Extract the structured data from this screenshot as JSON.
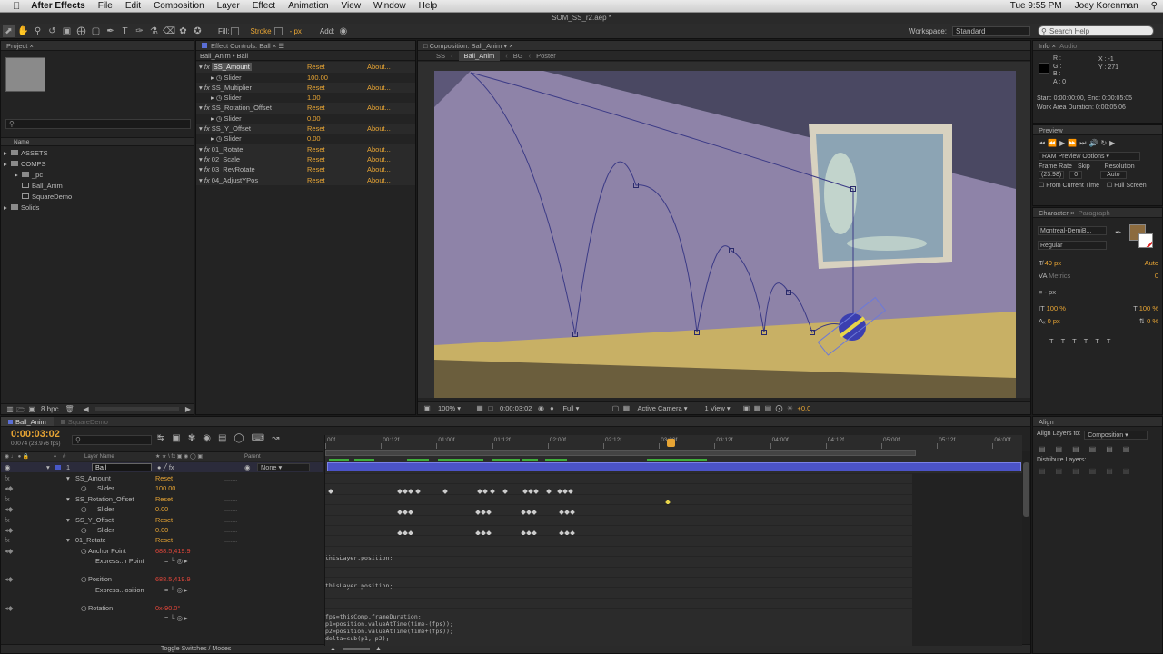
{
  "menubar": {
    "app": "After Effects",
    "items": [
      "File",
      "Edit",
      "Composition",
      "Layer",
      "Effect",
      "Animation",
      "View",
      "Window",
      "Help"
    ],
    "clock": "Tue 9:55 PM",
    "user": "Joey Korenman"
  },
  "window_title": "SOM_SS_r2.aep *",
  "toolbar": {
    "fill_label": "Fill:",
    "stroke_label": "Stroke",
    "px_label": "- px",
    "add_label": "Add:",
    "workspace_label": "Workspace:",
    "workspace_value": "Standard",
    "search_placeholder": "Search Help"
  },
  "project": {
    "tab": "Project",
    "column_name": "Name",
    "search_placeholder": "",
    "items": [
      {
        "label": "ASSETS",
        "indent": 0,
        "kind": "folder"
      },
      {
        "label": "COMPS",
        "indent": 0,
        "kind": "folder"
      },
      {
        "label": "_pc",
        "indent": 1,
        "kind": "folder"
      },
      {
        "label": "Ball_Anim",
        "indent": 1,
        "kind": "comp"
      },
      {
        "label": "SquareDemo",
        "indent": 1,
        "kind": "comp"
      },
      {
        "label": "Solids",
        "indent": 0,
        "kind": "folder"
      }
    ],
    "bpc": "8 bpc"
  },
  "effect_controls": {
    "tab": "Effect Controls: Ball",
    "header": "Ball_Anim • Ball",
    "rows": [
      {
        "name": "SS_Amount",
        "reset": "Reset",
        "about": "About...",
        "type": "fx"
      },
      {
        "name": "Slider",
        "value": "100.00",
        "type": "slider"
      },
      {
        "name": "SS_Multiplier",
        "reset": "Reset",
        "about": "About...",
        "type": "fx"
      },
      {
        "name": "Slider",
        "value": "1.00",
        "type": "slider"
      },
      {
        "name": "SS_Rotation_Offset",
        "reset": "Reset",
        "about": "About...",
        "type": "fx"
      },
      {
        "name": "Slider",
        "value": "0.00",
        "type": "slider"
      },
      {
        "name": "SS_Y_Offset",
        "reset": "Reset",
        "about": "About...",
        "type": "fx"
      },
      {
        "name": "Slider",
        "value": "0.00",
        "type": "slider"
      },
      {
        "name": "01_Rotate",
        "reset": "Reset",
        "about": "About...",
        "type": "fx"
      },
      {
        "name": "02_Scale",
        "reset": "Reset",
        "about": "About...",
        "type": "fx"
      },
      {
        "name": "03_RevRotate",
        "reset": "Reset",
        "about": "About...",
        "type": "fx"
      },
      {
        "name": "04_AdjustYPos",
        "reset": "Reset",
        "about": "About...",
        "type": "fx"
      }
    ]
  },
  "composition": {
    "tab": "Composition: Ball_Anim",
    "breadcrumbs": [
      "SS",
      "Ball_Anim",
      "BG",
      "Poster"
    ],
    "zoom": "100%",
    "timecode": "0:00:03:02",
    "resolution": "Full",
    "camera": "Active Camera",
    "views": "1 View",
    "exposure": "+0.0"
  },
  "info": {
    "tabs": [
      "Info",
      "Audio"
    ],
    "r": "R :",
    "g": "G :",
    "b": "B :",
    "a": "A : 0",
    "x": "X : -1",
    "y": "Y : 271",
    "start": "Start: 0:00:00:00, End: 0:00:05:05",
    "work_area": "Work Area Duration: 0:00:05:06"
  },
  "preview": {
    "tab": "Preview",
    "options": "RAM Preview Options",
    "frame_rate_label": "Frame Rate",
    "skip_label": "Skip",
    "resolution_label": "Resolution",
    "frame_rate": "(23.98)",
    "skip": "0",
    "resolution": "Auto",
    "from_current": "From Current Time",
    "full_screen": "Full Screen"
  },
  "character": {
    "tabs": [
      "Character",
      "Paragraph"
    ],
    "font": "Montreal-DemiB...",
    "style": "Regular",
    "size": "49 px",
    "leading": "Auto",
    "kerning": "Metrics",
    "tracking": "0",
    "stroke_width": "- px",
    "vscale": "100 %",
    "hscale": "100 %",
    "baseline": "0 px",
    "tsume": "0 %",
    "swatch_color": "#8c6b3e"
  },
  "align": {
    "tab": "Align",
    "align_to_label": "Align Layers to:",
    "align_to_value": "Composition",
    "distribute_label": "Distribute Layers:"
  },
  "timeline": {
    "tabs": [
      "Ball_Anim",
      "SquareDemo"
    ],
    "timecode": "0:00:03:02",
    "frames": "00074 (23.976 fps)",
    "col_layer_name": "Layer Name",
    "col_parent": "Parent",
    "parent_value": "None",
    "toggle_label": "Toggle Switches / Modes",
    "ruler": [
      "00f",
      "00:12f",
      "01:00f",
      "01:12f",
      "02:00f",
      "02:12f",
      "03:00f",
      "03:12f",
      "04:00f",
      "04:12f",
      "05:00f",
      "05:12f",
      "06:00f"
    ],
    "layer": {
      "num": "1",
      "name": "Ball"
    },
    "props": [
      {
        "label": "SS_Amount",
        "value": "Reset",
        "indent": 1,
        "kind": "fx"
      },
      {
        "label": "Slider",
        "value": "100.00",
        "indent": 2,
        "kind": "slider"
      },
      {
        "label": "SS_Rotation_Offset",
        "value": "Reset",
        "indent": 1,
        "kind": "fx"
      },
      {
        "label": "Slider",
        "value": "0.00",
        "indent": 2,
        "kind": "slider"
      },
      {
        "label": "SS_Y_Offset",
        "value": "Reset",
        "indent": 1,
        "kind": "fx"
      },
      {
        "label": "Slider",
        "value": "0.00",
        "indent": 2,
        "kind": "slider"
      },
      {
        "label": "01_Rotate",
        "value": "Reset",
        "indent": 1,
        "kind": "fx"
      },
      {
        "label": "Anchor Point",
        "value": "688.5,419.9",
        "indent": 2,
        "kind": "red"
      },
      {
        "label": "Express...r Point",
        "value": "",
        "indent": 3,
        "kind": "expr"
      },
      {
        "label": "Position",
        "value": "688.5,419.9",
        "indent": 2,
        "kind": "red"
      },
      {
        "label": "Express...osition",
        "value": "",
        "indent": 3,
        "kind": "expr"
      },
      {
        "label": "Rotation",
        "value": "0x-90.0°",
        "indent": 2,
        "kind": "red"
      },
      {
        "label": "",
        "value": "",
        "indent": 3,
        "kind": "expr"
      }
    ],
    "expressions": [
      "thisLayer.position;",
      "thisLayer.position;",
      "fps=thisComp.frameDuration;",
      "p1=position.valueAtTime(time-(fps));",
      "p2=position.valueAtTime(time+(fps));",
      "delta=sub(p1, p2);"
    ]
  }
}
